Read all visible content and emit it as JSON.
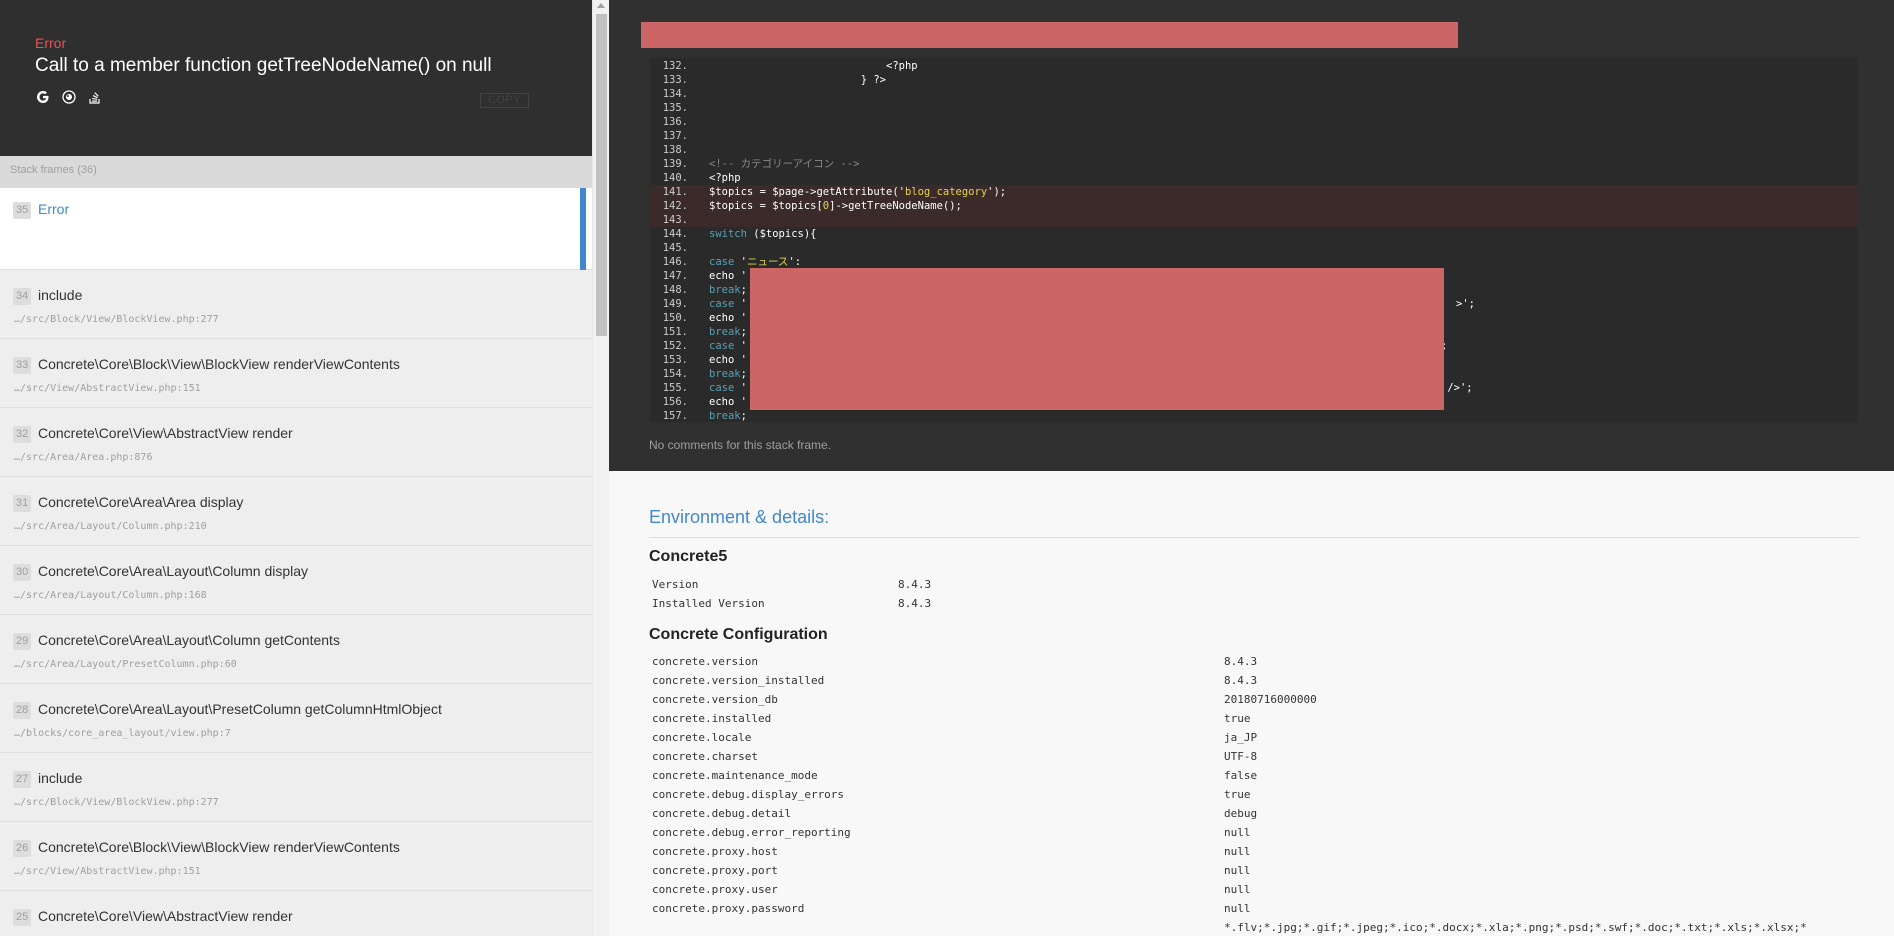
{
  "exception": {
    "type": "Error",
    "message": "Call to a member function getTreeNodeName() on null",
    "copy_label": "COPY",
    "icons": [
      "google-icon",
      "duckduckgo-icon",
      "stackoverflow-icon"
    ]
  },
  "stack": {
    "header": "Stack frames (36)",
    "frames": [
      {
        "index": "35",
        "class": "Error",
        "file": ""
      },
      {
        "index": "34",
        "class": "include",
        "file": "…/src/Block/View/BlockView.php:277"
      },
      {
        "index": "33",
        "class": "Concrete\\Core\\Block\\View\\BlockView renderViewContents",
        "file": "…/src/View/AbstractView.php:151"
      },
      {
        "index": "32",
        "class": "Concrete\\Core\\View\\AbstractView render",
        "file": "…/src/Area/Area.php:876"
      },
      {
        "index": "31",
        "class": "Concrete\\Core\\Area\\Area display",
        "file": "…/src/Area/Layout/Column.php:210"
      },
      {
        "index": "30",
        "class": "Concrete\\Core\\Area\\Layout\\Column display",
        "file": "…/src/Area/Layout/Column.php:168"
      },
      {
        "index": "29",
        "class": "Concrete\\Core\\Area\\Layout\\Column getContents",
        "file": "…/src/Area/Layout/PresetColumn.php:60"
      },
      {
        "index": "28",
        "class": "Concrete\\Core\\Area\\Layout\\PresetColumn getColumnHtmlObject",
        "file": "…/blocks/core_area_layout/view.php:7"
      },
      {
        "index": "27",
        "class": "include",
        "file": "…/src/Block/View/BlockView.php:277"
      },
      {
        "index": "26",
        "class": "Concrete\\Core\\Block\\View\\BlockView renderViewContents",
        "file": "…/src/View/AbstractView.php:151"
      },
      {
        "index": "25",
        "class": "Concrete\\Core\\View\\AbstractView render",
        "file": ""
      }
    ]
  },
  "code": {
    "lines": [
      {
        "n": "132.",
        "t": "                            <?php"
      },
      {
        "n": "133.",
        "t": "                        } ?>"
      },
      {
        "n": "134.",
        "t": ""
      },
      {
        "n": "135.",
        "t": ""
      },
      {
        "n": "136.",
        "t": ""
      },
      {
        "n": "137.",
        "t": ""
      },
      {
        "n": "138.",
        "t": ""
      },
      {
        "n": "139.",
        "t": "<!-- カテゴリーアイコン -->"
      },
      {
        "n": "140.",
        "t": "<?php"
      },
      {
        "n": "141.",
        "t": "$topics = $page->getAttribute('blog_category');"
      },
      {
        "n": "142.",
        "t": "$topics = $topics[0]->getTreeNodeName();"
      },
      {
        "n": "143.",
        "t": ""
      },
      {
        "n": "144.",
        "t": "switch ($topics){"
      },
      {
        "n": "145.",
        "t": ""
      },
      {
        "n": "146.",
        "t": "case 'ニュース':"
      },
      {
        "n": "147.",
        "t": "echo '"
      },
      {
        "n": "148.",
        "t": "break;"
      },
      {
        "n": "149.",
        "t": "case '"
      },
      {
        "n": "150.",
        "t": "echo '"
      },
      {
        "n": "151.",
        "t": "break;"
      },
      {
        "n": "152.",
        "t": "case '"
      },
      {
        "n": "153.",
        "t": "echo '"
      },
      {
        "n": "154.",
        "t": "break;"
      },
      {
        "n": "155.",
        "t": "case '"
      },
      {
        "n": "156.",
        "t": "echo '"
      },
      {
        "n": "157.",
        "t": "break;"
      }
    ],
    "tail_150": ">';",
    "tail_153": ";",
    "tail_156": " />';",
    "no_comments": "No comments for this stack frame."
  },
  "env": {
    "title": "Environment & details:",
    "concrete5": {
      "heading": "Concrete5",
      "rows": [
        {
          "k": "Version",
          "v": "8.4.3"
        },
        {
          "k": "Installed Version",
          "v": "8.4.3"
        }
      ]
    },
    "config": {
      "heading": "Concrete Configuration",
      "rows": [
        {
          "k": "concrete.version",
          "v": "8.4.3"
        },
        {
          "k": "concrete.version_installed",
          "v": "8.4.3"
        },
        {
          "k": "concrete.version_db",
          "v": "20180716000000"
        },
        {
          "k": "concrete.installed",
          "v": "true"
        },
        {
          "k": "concrete.locale",
          "v": "ja_JP"
        },
        {
          "k": "concrete.charset",
          "v": "UTF-8"
        },
        {
          "k": "concrete.maintenance_mode",
          "v": "false"
        },
        {
          "k": "concrete.debug.display_errors",
          "v": "true"
        },
        {
          "k": "concrete.debug.detail",
          "v": "debug"
        },
        {
          "k": "concrete.debug.error_reporting",
          "v": "null"
        },
        {
          "k": "concrete.proxy.host",
          "v": "null"
        },
        {
          "k": "concrete.proxy.port",
          "v": "null"
        },
        {
          "k": "concrete.proxy.user",
          "v": "null"
        },
        {
          "k": "concrete.proxy.password",
          "v": "null"
        },
        {
          "k": "",
          "v": "*.flv;*.jpg;*.gif;*.jpeg;*.ico;*.docx;*.xla;*.png;*.psd;*.swf;*.doc;*.txt;*.xls;*.xlsx;*"
        }
      ]
    }
  }
}
